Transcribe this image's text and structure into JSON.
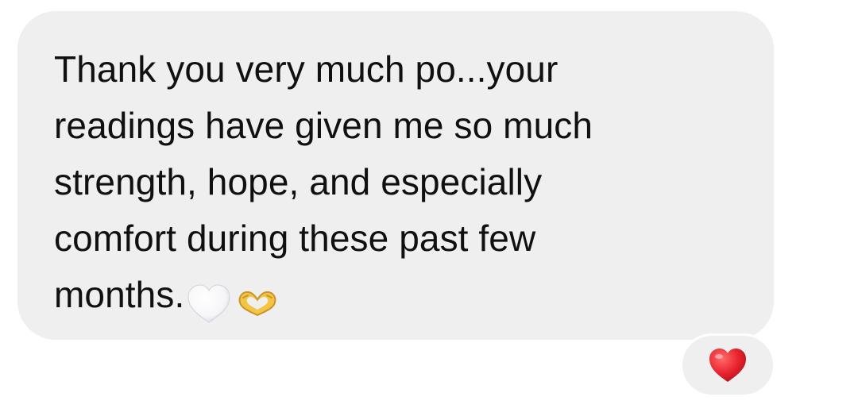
{
  "message": {
    "lines": [
      "Thank you very much po...your",
      "readings have given me so much",
      "strength, hope, and especially",
      "comfort during these past few",
      "months."
    ],
    "emojis": [
      "white-heart-icon",
      "heart-hands-icon"
    ]
  },
  "reaction": {
    "emoji": "red-heart-icon"
  },
  "colors": {
    "bubble": "#efeff0",
    "text": "#101010",
    "reaction_heart": "#e8232e",
    "heart_hands": "#f4c542"
  }
}
